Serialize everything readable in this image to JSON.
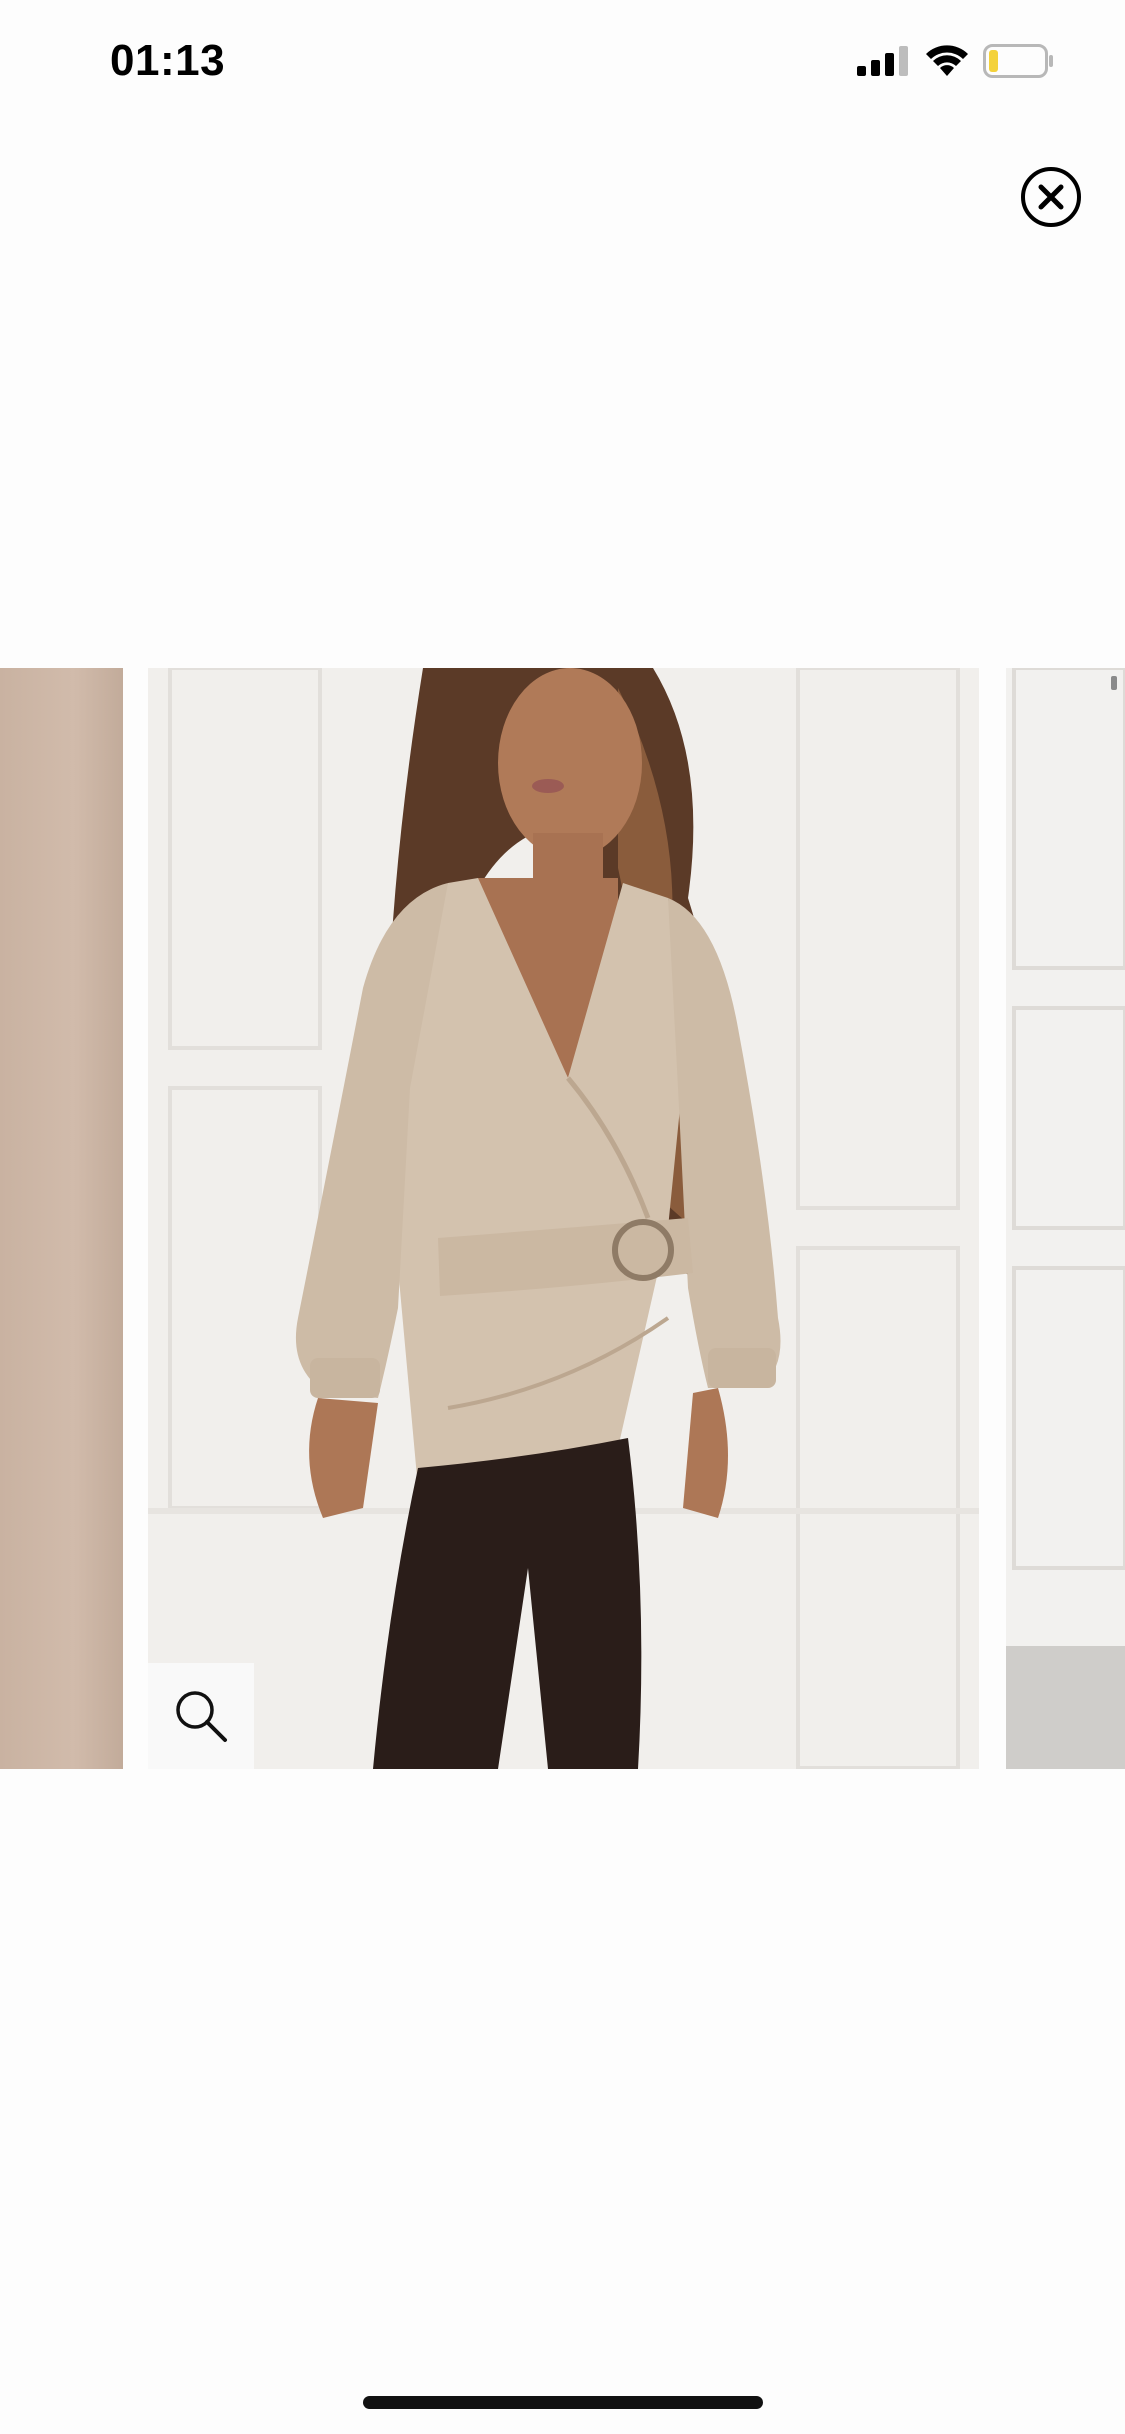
{
  "status_bar": {
    "time": "01:13",
    "icons": [
      "cellular-signal-icon",
      "wifi-icon",
      "battery-icon"
    ],
    "battery_color": "#f4d23b"
  },
  "viewer": {
    "close_icon": "close-icon",
    "zoom_icon": "search-icon"
  },
  "gallery": {
    "main_image": "product-photo-beige-faux-leather-wrap-top-with-belt",
    "colors": {
      "top": "#d3c2ae",
      "pants": "#2a1d19",
      "background": "#f1efec"
    }
  }
}
